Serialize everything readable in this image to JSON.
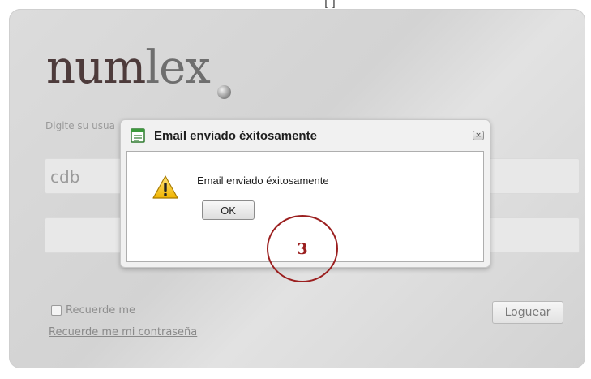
{
  "top_fragment": "[ ]",
  "login": {
    "logo_prefix": "num",
    "logo_suffix": "lex",
    "prompt": "Digite su usua",
    "username_value": "cdb",
    "remember_label": "Recuerde me",
    "forgot_link": "Recuerde me mi contraseña",
    "login_button": "Loguear"
  },
  "dialog": {
    "title": "Email enviado éxitosamente",
    "message": "Email enviado éxitosamente",
    "ok_label": "OK",
    "close_glyph": "×",
    "title_icon": "window-icon",
    "message_icon": "warning-icon"
  },
  "annotation": {
    "step_number": "3",
    "color": "#9b1f1f"
  }
}
